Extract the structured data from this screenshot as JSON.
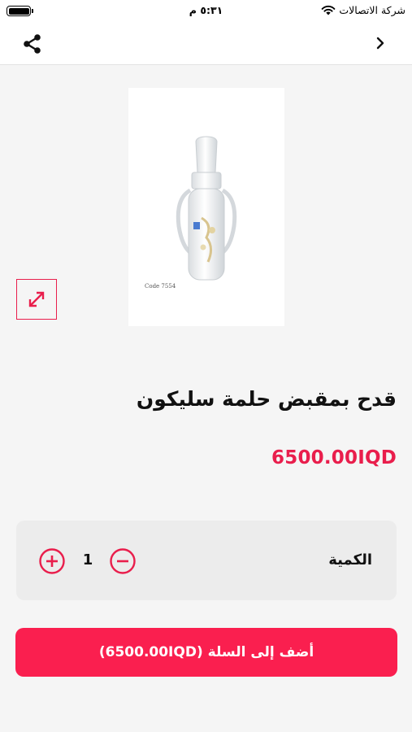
{
  "status_bar": {
    "carrier": "شركة الاتصالات",
    "time": "٥:٣١ م",
    "icons": [
      "wifi-icon",
      "battery-icon"
    ]
  },
  "nav": {
    "icons": [
      "chevron-right-icon",
      "share-icon"
    ]
  },
  "product": {
    "image_label": "Code 7554",
    "title": "قدح بمقبض حلمة سليكون",
    "price": "6500.00IQD"
  },
  "quantity": {
    "label": "الكمية",
    "value": "1",
    "icons": [
      "plus-circle-icon",
      "minus-circle-icon"
    ]
  },
  "cart": {
    "button_label": "أضف إلى السلة (6500.00IQD)"
  },
  "colors": {
    "accent": "#e91e4c",
    "button": "#fa1f4f"
  }
}
